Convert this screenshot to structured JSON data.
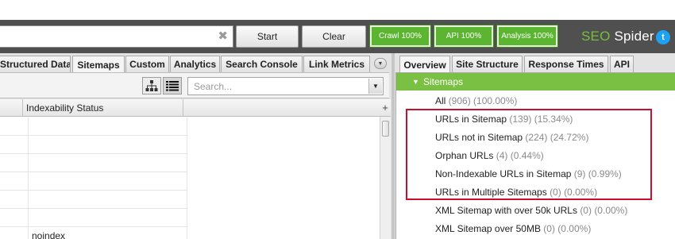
{
  "toolbar": {
    "url_value": "",
    "clear_icon": "close-icon",
    "start_label": "Start",
    "clear_label": "Clear",
    "crawl_label": "Crawl 100%",
    "api_label": "API 100%",
    "analysis_label": "Analysis 100%",
    "brand_seo": "SEO",
    "brand_spider": " Spider",
    "twitter_icon": "twitter-icon",
    "accent_green": "#5cb531"
  },
  "left_tabs": {
    "items": [
      {
        "label": "Structured Data"
      },
      {
        "label": "Sitemaps",
        "active": true
      },
      {
        "label": "Custom"
      },
      {
        "label": "Analytics"
      },
      {
        "label": "Search Console"
      },
      {
        "label": "Link Metrics"
      }
    ],
    "overflow_icon": "chevron-down-icon"
  },
  "left_toolbar": {
    "tree_view_icon": "tree-view-icon",
    "list_view_icon": "list-view-icon",
    "search_placeholder": "Search..."
  },
  "grid": {
    "header": "Indexability Status",
    "add_column_icon": "plus-icon",
    "rows": [
      "",
      "",
      "",
      "",
      "",
      "",
      "noindex"
    ]
  },
  "right_tabs": {
    "items": [
      {
        "label": "Overview",
        "active": true
      },
      {
        "label": "Site Structure"
      },
      {
        "label": "Response Times"
      },
      {
        "label": "API"
      }
    ]
  },
  "overview": {
    "section": "Sitemaps",
    "section_color": "#7ac143",
    "items": [
      {
        "label": "All",
        "count": "(906) (100.00%)"
      },
      {
        "label": "URLs in Sitemap",
        "count": "(139) (15.34%)"
      },
      {
        "label": "URLs not in Sitemap",
        "count": "(224) (24.72%)"
      },
      {
        "label": "Orphan URLs",
        "count": "(4) (0.44%)"
      },
      {
        "label": "Non-Indexable URLs in Sitemap",
        "count": "(9) (0.99%)"
      },
      {
        "label": "URLs in Multiple Sitemaps",
        "count": "(0) (0.00%)"
      },
      {
        "label": "XML Sitemap with over 50k URLs",
        "count": "(0) (0.00%)"
      },
      {
        "label": "XML Sitemap over 50MB",
        "count": "(0) (0.00%)"
      }
    ],
    "highlight_color": "#c8102e"
  }
}
